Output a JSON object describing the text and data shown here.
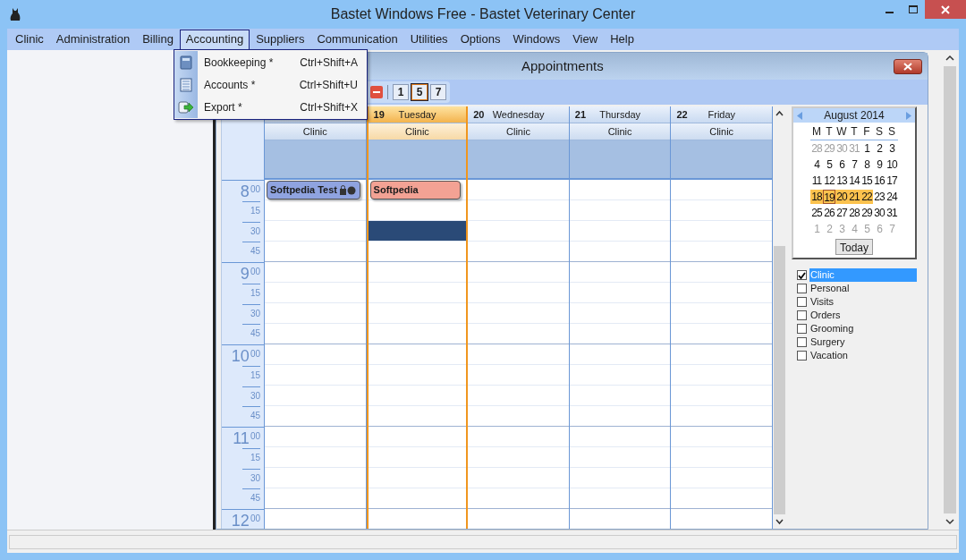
{
  "window": {
    "title": "Bastet Windows Free - Bastet Veterinary Center"
  },
  "menu": [
    {
      "label": "Clinic",
      "selected": false
    },
    {
      "label": "Administration",
      "selected": false
    },
    {
      "label": "Billing",
      "selected": false
    },
    {
      "label": "Accounting",
      "selected": true
    },
    {
      "label": "Suppliers",
      "selected": false
    },
    {
      "label": "Communication",
      "selected": false
    },
    {
      "label": "Utilities",
      "selected": false
    },
    {
      "label": "Options",
      "selected": false
    },
    {
      "label": "Windows",
      "selected": false
    },
    {
      "label": "View",
      "selected": false
    },
    {
      "label": "Help",
      "selected": false
    }
  ],
  "dropdown": [
    {
      "kind": "book",
      "label": "Bookkeeping *",
      "shortcut": "Ctrl+Shift+A"
    },
    {
      "kind": "ledger",
      "label": "Accounts *",
      "shortcut": "Ctrl+Shift+U"
    },
    {
      "kind": "export",
      "label": "Export *",
      "shortcut": "Ctrl+Shift+X"
    }
  ],
  "appointments_window": {
    "title": "Appointments",
    "views": [
      {
        "label": "1",
        "selected": false
      },
      {
        "label": "5",
        "selected": true
      },
      {
        "label": "7",
        "selected": false
      }
    ],
    "times": [
      {
        "hour": "8",
        "minutes": "00",
        "quarters": [
          "15",
          "30",
          "45"
        ]
      },
      {
        "hour": "9",
        "minutes": "00",
        "quarters": [
          "15",
          "30",
          "45"
        ]
      },
      {
        "hour": "10",
        "minutes": "00",
        "quarters": [
          "15",
          "30",
          "45"
        ]
      },
      {
        "hour": "11",
        "minutes": "00",
        "quarters": [
          "15",
          "30",
          "45"
        ]
      },
      {
        "hour": "12",
        "minutes": "00"
      }
    ],
    "days": [
      {
        "category": "Clinic",
        "selected": false,
        "slots": [
          false,
          false,
          false,
          false,
          false,
          false,
          false,
          false,
          false,
          false,
          false,
          false,
          false,
          false,
          false,
          false,
          false
        ],
        "appointments": [
          {
            "title": "Softpedia Test",
            "color": "#8fa3e0",
            "locked": true
          }
        ]
      },
      {
        "number": "19",
        "name": "Tuesday",
        "category": "Clinic",
        "selected": true,
        "slots": [
          false,
          false,
          true,
          false,
          false,
          false,
          false,
          false,
          false,
          false,
          false,
          false,
          false,
          false,
          false,
          false,
          false
        ],
        "appointments": [
          {
            "title": "Softpedia",
            "color": "#f3a294",
            "locked": false
          }
        ]
      },
      {
        "number": "20",
        "name": "Wednesday",
        "category": "Clinic",
        "selected": false,
        "slots": [
          false,
          false,
          false,
          false,
          false,
          false,
          false,
          false,
          false,
          false,
          false,
          false,
          false,
          false,
          false,
          false,
          false
        ]
      },
      {
        "number": "21",
        "name": "Thursday",
        "category": "Clinic",
        "selected": false,
        "slots": [
          false,
          false,
          false,
          false,
          false,
          false,
          false,
          false,
          false,
          false,
          false,
          false,
          false,
          false,
          false,
          false,
          false
        ]
      },
      {
        "number": "22",
        "name": "Friday",
        "category": "Clinic",
        "selected": false,
        "slots": [
          false,
          false,
          false,
          false,
          false,
          false,
          false,
          false,
          false,
          false,
          false,
          false,
          false,
          false,
          false,
          false,
          false
        ]
      }
    ],
    "calendar": {
      "month": "August 2014",
      "weekdays": [
        "M",
        "T",
        "W",
        "T",
        "F",
        "S",
        "S"
      ],
      "weeks": [
        [
          {
            "d": "28",
            "muted": true,
            "highlighted": false,
            "selected": false
          },
          {
            "d": "29",
            "muted": true,
            "highlighted": false,
            "selected": false
          },
          {
            "d": "30",
            "muted": true,
            "highlighted": false,
            "selected": false
          },
          {
            "d": "31",
            "muted": true,
            "highlighted": false,
            "selected": false
          },
          {
            "d": "1",
            "muted": false,
            "highlighted": false,
            "selected": false
          },
          {
            "d": "2",
            "muted": false,
            "highlighted": false,
            "selected": false
          },
          {
            "d": "3",
            "muted": false,
            "highlighted": false,
            "selected": false
          }
        ],
        [
          {
            "d": "4",
            "muted": false,
            "highlighted": false,
            "selected": false
          },
          {
            "d": "5",
            "muted": false,
            "highlighted": false,
            "selected": false
          },
          {
            "d": "6",
            "muted": false,
            "highlighted": false,
            "selected": false
          },
          {
            "d": "7",
            "muted": false,
            "highlighted": false,
            "selected": false
          },
          {
            "d": "8",
            "muted": false,
            "highlighted": false,
            "selected": false
          },
          {
            "d": "9",
            "muted": false,
            "highlighted": false,
            "selected": false
          },
          {
            "d": "10",
            "muted": false,
            "highlighted": false,
            "selected": false
          }
        ],
        [
          {
            "d": "11",
            "muted": false,
            "highlighted": false,
            "selected": false
          },
          {
            "d": "12",
            "muted": false,
            "highlighted": false,
            "selected": false
          },
          {
            "d": "13",
            "muted": false,
            "highlighted": false,
            "selected": false
          },
          {
            "d": "14",
            "muted": false,
            "highlighted": false,
            "selected": false
          },
          {
            "d": "15",
            "muted": false,
            "highlighted": false,
            "selected": false
          },
          {
            "d": "16",
            "muted": false,
            "highlighted": false,
            "selected": false
          },
          {
            "d": "17",
            "muted": false,
            "highlighted": false,
            "selected": false
          }
        ],
        [
          {
            "d": "18",
            "muted": false,
            "highlighted": true,
            "selected": false
          },
          {
            "d": "19",
            "muted": false,
            "highlighted": true,
            "selected": true
          },
          {
            "d": "20",
            "muted": false,
            "highlighted": true,
            "selected": false
          },
          {
            "d": "21",
            "muted": false,
            "highlighted": true,
            "selected": false
          },
          {
            "d": "22",
            "muted": false,
            "highlighted": true,
            "selected": false
          },
          {
            "d": "23",
            "muted": false,
            "highlighted": false,
            "selected": false
          },
          {
            "d": "24",
            "muted": false,
            "highlighted": false,
            "selected": false
          }
        ],
        [
          {
            "d": "25",
            "muted": false,
            "highlighted": false,
            "selected": false
          },
          {
            "d": "26",
            "muted": false,
            "highlighted": false,
            "selected": false
          },
          {
            "d": "27",
            "muted": false,
            "highlighted": false,
            "selected": false
          },
          {
            "d": "28",
            "muted": false,
            "highlighted": false,
            "selected": false
          },
          {
            "d": "29",
            "muted": false,
            "highlighted": false,
            "selected": false
          },
          {
            "d": "30",
            "muted": false,
            "highlighted": false,
            "selected": false
          },
          {
            "d": "31",
            "muted": false,
            "highlighted": false,
            "selected": false
          }
        ],
        [
          {
            "d": "1",
            "muted": true,
            "highlighted": false,
            "selected": false
          },
          {
            "d": "2",
            "muted": true,
            "highlighted": false,
            "selected": false
          },
          {
            "d": "3",
            "muted": true,
            "highlighted": false,
            "selected": false
          },
          {
            "d": "4",
            "muted": true,
            "highlighted": false,
            "selected": false
          },
          {
            "d": "5",
            "muted": true,
            "highlighted": false,
            "selected": false
          },
          {
            "d": "6",
            "muted": true,
            "highlighted": false,
            "selected": false
          },
          {
            "d": "7",
            "muted": true,
            "highlighted": false,
            "selected": false
          }
        ]
      ],
      "today_button": "Today"
    },
    "categories": [
      {
        "label": "Clinic",
        "checked": true,
        "selected": true
      },
      {
        "label": "Personal",
        "checked": false,
        "selected": false
      },
      {
        "label": "Visits",
        "checked": false,
        "selected": false
      },
      {
        "label": "Orders",
        "checked": false,
        "selected": false
      },
      {
        "label": "Grooming",
        "checked": false,
        "selected": false
      },
      {
        "label": "Surgery",
        "checked": false,
        "selected": false
      },
      {
        "label": "Vacation",
        "checked": false,
        "selected": false
      }
    ]
  }
}
